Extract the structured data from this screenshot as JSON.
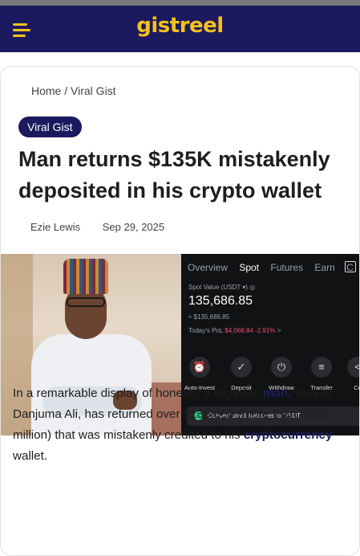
{
  "header": {
    "logo_text": "gistreel",
    "menu_icon": "hamburger-menu-icon"
  },
  "breadcrumb": {
    "home": "Home",
    "separator": "/",
    "category": "Viral Gist"
  },
  "article": {
    "badge": "Viral Gist",
    "title": "Man returns $135K mistakenly deposited in his crypto wallet",
    "author": "Ezie Lewis",
    "date": "Sep 29, 2025",
    "body": {
      "part1": "In a remarkable display of honesty, a Nigerian ",
      "link1": "man,",
      "part2": " Sunusi Danjuma Ali, has returned over $135,000 (more than N200 million) that was mistakenly credited to his ",
      "link2": "cryptocurrency",
      "part3": " wallet."
    }
  },
  "hero_image": {
    "app_tabs": [
      "Overview",
      "Spot",
      "Futures",
      "Earn",
      "C"
    ],
    "spot_value_label": "Spot Value (USDT ▾) ◎",
    "spot_value": "135,686.85",
    "spot_value_sub": "≈ $135,686.85",
    "pnl_label": "Today's PnL",
    "pnl_value": "$4,068.84 -2.91%",
    "pnl_arrow": ">",
    "actions": [
      {
        "label": "Auto-Invest",
        "icon": "⏰"
      },
      {
        "label": "Deposit",
        "icon": "✓"
      },
      {
        "label": "Withdraw",
        "icon": "⏻"
      },
      {
        "label": "Transfer",
        "icon": "≡"
      },
      {
        "label": "Co",
        "icon": "<"
      }
    ],
    "convert_label": "Convert small balances to USDT"
  },
  "colors": {
    "brand_navy": "#1c1a5e",
    "brand_yellow": "#f5c21b",
    "pnl_red": "#f0506e"
  }
}
